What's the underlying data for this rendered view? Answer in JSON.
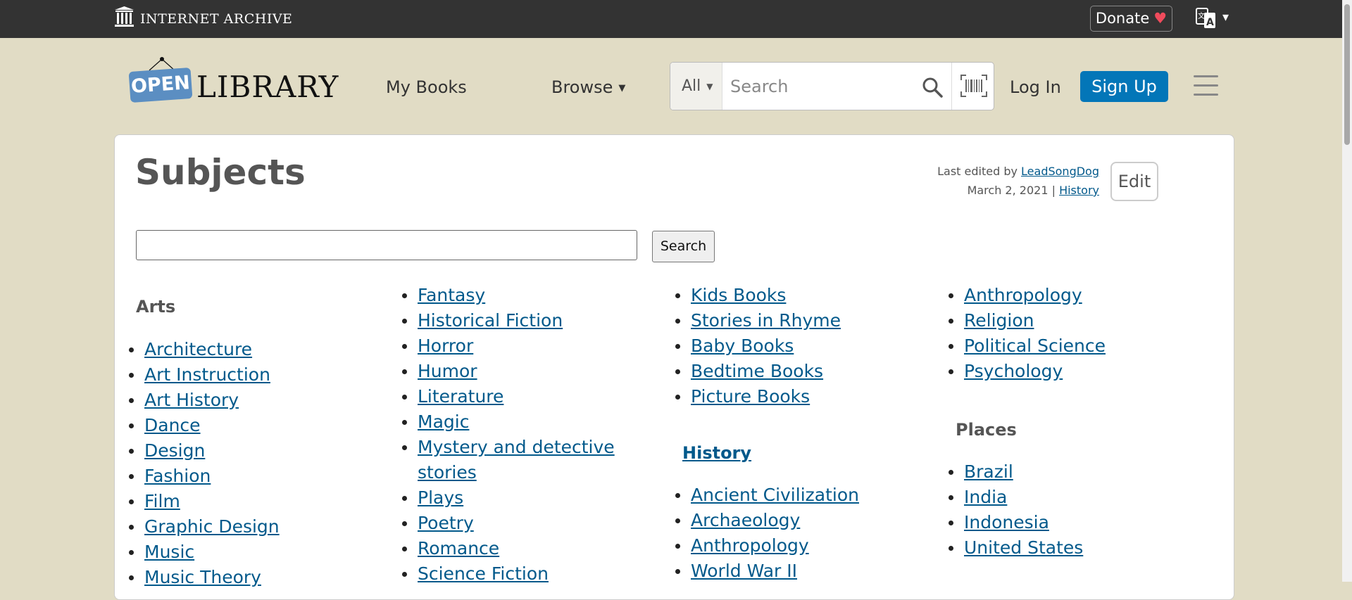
{
  "ia_bar": {
    "brand": "INTERNET ARCHIVE",
    "donate_label": "Donate",
    "donate_heart": "♥",
    "language_caret": "▾"
  },
  "header": {
    "logo_open": "OPEN",
    "logo_library": "LIBRARY",
    "my_books": "My Books",
    "browse": "Browse",
    "search_scope": "All",
    "search_placeholder": "Search",
    "login": "Log In",
    "signup": "Sign Up"
  },
  "page": {
    "title": "Subjects",
    "last_edited_prefix": "Last edited by",
    "last_edited_user": "LeadSongDog",
    "last_edited_date": "March 2, 2021",
    "separator": "|",
    "history_link": "History",
    "edit_label": "Edit",
    "search_button": "Search"
  },
  "columns": {
    "arts": {
      "heading": "Arts",
      "items": [
        "Architecture",
        "Art Instruction",
        "Art History",
        "Dance",
        "Design",
        "Fashion",
        "Film",
        "Graphic Design",
        "Music",
        "Music Theory"
      ]
    },
    "fiction": {
      "items": [
        "Fantasy",
        "Historical Fiction",
        "Horror",
        "Humor",
        "Literature",
        "Magic",
        "Mystery and detective",
        "stories",
        "Plays",
        "Poetry",
        "Romance",
        "Science Fiction"
      ]
    },
    "kids": {
      "items": [
        "Kids Books",
        "Stories in Rhyme",
        "Baby Books",
        "Bedtime Books",
        "Picture Books"
      ]
    },
    "history": {
      "heading": "History",
      "items": [
        "Ancient Civilization",
        "Archaeology",
        "Anthropology",
        "World War II"
      ]
    },
    "social": {
      "items": [
        "Anthropology",
        "Religion",
        "Political Science",
        "Psychology"
      ]
    },
    "places": {
      "heading": "Places",
      "items": [
        "Brazil",
        "India",
        "Indonesia",
        "United States"
      ]
    }
  },
  "colors": {
    "page_background": "#e1dcc5",
    "top_bar": "#333333",
    "link": "#02598b",
    "signup_button": "#0376b8"
  },
  "icons": [
    "archive-pillars-icon",
    "language-icon",
    "search-icon",
    "barcode-scanner-icon",
    "hamburger-menu-icon"
  ]
}
